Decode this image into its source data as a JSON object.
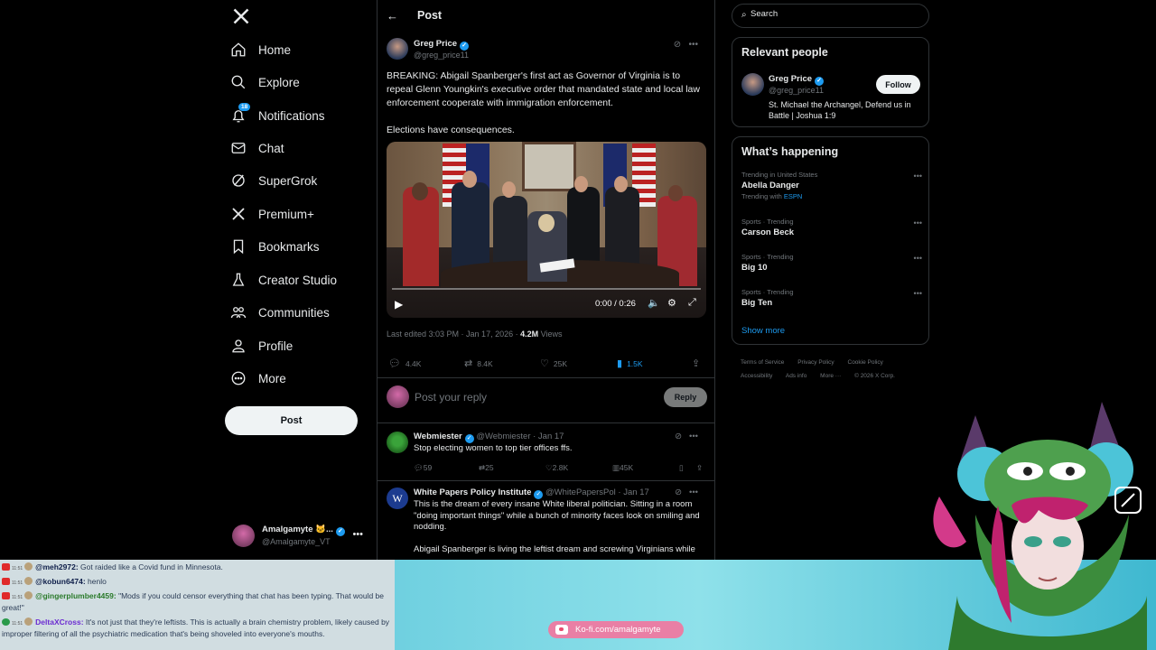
{
  "nav": {
    "items": [
      {
        "label": "Home",
        "icon": "home-icon"
      },
      {
        "label": "Explore",
        "icon": "search-icon"
      },
      {
        "label": "Notifications",
        "icon": "bell-icon",
        "badge": "18"
      },
      {
        "label": "Chat",
        "icon": "mail-icon"
      },
      {
        "label": "SuperGrok",
        "icon": "grok-icon"
      },
      {
        "label": "Premium+",
        "icon": "x-icon"
      },
      {
        "label": "Bookmarks",
        "icon": "bookmark-icon"
      },
      {
        "label": "Creator Studio",
        "icon": "flask-icon"
      },
      {
        "label": "Communities",
        "icon": "people-icon"
      },
      {
        "label": "Profile",
        "icon": "person-icon"
      },
      {
        "label": "More",
        "icon": "more-circle-icon"
      }
    ],
    "post_button": "Post",
    "account": {
      "name": "Amalgamyte 🐱...",
      "handle": "@Amalgamyte_VT"
    }
  },
  "post": {
    "header_title": "Post",
    "author": {
      "name": "Greg Price",
      "handle": "@greg_price11"
    },
    "text_1": "BREAKING: Abigail Spanberger's first act as Governor of Virginia is to repeal Glenn Youngkin's executive order that mandated state and local law enforcement cooperate with immigration enforcement.",
    "text_2": "Elections have consequences.",
    "video": {
      "time": "0:00 / 0:26",
      "progress": 0.0
    },
    "meta_prefix": "Last edited 3:03 PM · Jan 17, 2026 · ",
    "views_count": "4.2M",
    "views_label": " Views",
    "stats": {
      "replies": "4.4K",
      "reposts": "8.4K",
      "likes": "25K",
      "bookmarks": "1.5K"
    },
    "reply_placeholder": "Post your reply",
    "reply_button": "Reply"
  },
  "replies": [
    {
      "name": "Webmiester",
      "meta": "@Webmiester · Jan 17",
      "text": [
        "Stop electing women to top tier offices ffs."
      ],
      "stats": {
        "replies": "59",
        "reposts": "25",
        "likes": "2.8K",
        "views": "45K"
      }
    },
    {
      "name": "White Papers Policy Institute",
      "meta": "@WhitePapersPol · Jan 17",
      "text": [
        "This is the dream of every insane White liberal politician.  Sitting in a room \"doing important things\" while a bunch of minority faces look on smiling and nodding.",
        "Abigail Spanberger is living the leftist dream and screwing Virginians while"
      ]
    }
  ],
  "sidebar": {
    "search_placeholder": "Search",
    "relevant_title": "Relevant people",
    "person": {
      "name": "Greg Price",
      "handle": "@greg_price11",
      "follow_label": "Follow",
      "bio": "St. Michael the Archangel, Defend us in Battle | Joshua 1:9"
    },
    "happening_title": "What’s happening",
    "trends": [
      {
        "context": "Trending in United States",
        "name": "Abella Danger",
        "sub_prefix": "Trending with ",
        "sub_link": "ESPN"
      },
      {
        "context": "Sports · Trending",
        "name": "Carson Beck"
      },
      {
        "context": "Sports · Trending",
        "name": "Big 10"
      },
      {
        "context": "Sports · Trending",
        "name": "Big Ten"
      }
    ],
    "show_more": "Show more",
    "footer": [
      "Terms of Service",
      "Privacy Policy",
      "Cookie Policy",
      "Accessibility",
      "Ads info",
      "More ···",
      "© 2026 X Corp."
    ]
  },
  "stream": {
    "chat": [
      {
        "user": "@meh2972:",
        "msg": " Got raided like a Covid fund in Minnesota."
      },
      {
        "user": "@kobun6474:",
        "msg": " henlo"
      },
      {
        "user": "@gingerplumber4459:",
        "msg": " \"Mods if you could censor everything that chat has been typing. That would be great!\""
      },
      {
        "user": "DeltaXCross:",
        "msg": " It's not just that they're leftists. This is actually a brain chemistry problem, likely caused by improper filtering of all the psychiatric medication that's being shoveled into everyone's mouths."
      }
    ],
    "kofi": "Ko-fi.com/amalgamyte",
    "colors": {
      "accent": "#1d9bf0",
      "kofi": "#e97fa5"
    }
  }
}
